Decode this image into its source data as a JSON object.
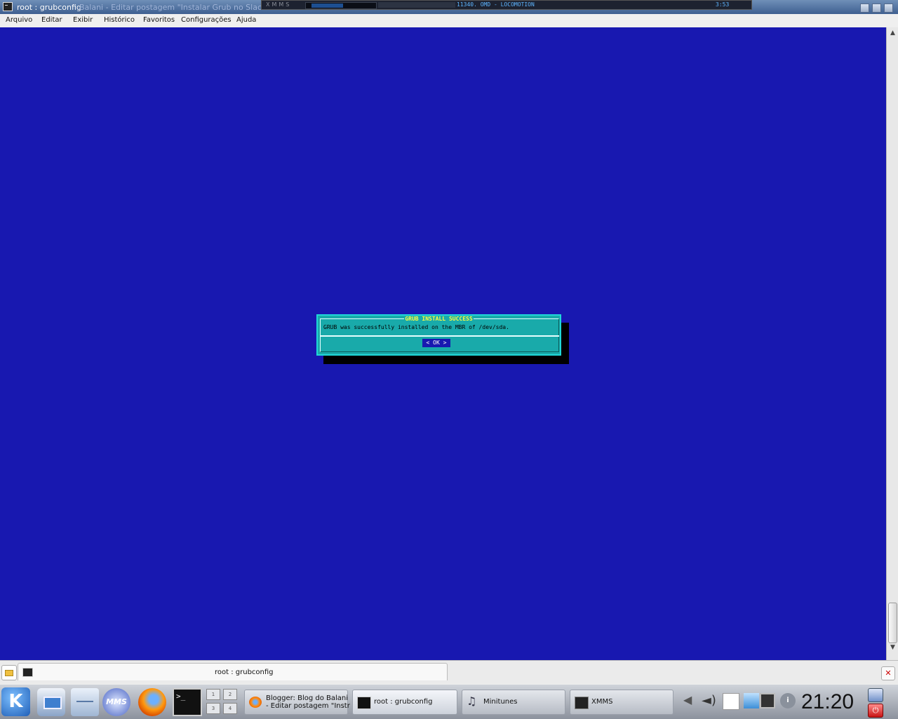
{
  "window": {
    "title_active": "root : grubconfig",
    "title_rest": "Balani - Editar postagem \"Instalar Grub no Slack"
  },
  "xmms_bar": {
    "label": "XMMS",
    "track": "11340. OMD - LOCOMOTION",
    "time": "3:53"
  },
  "menu": {
    "items": [
      "Arquivo",
      "Editar",
      "Exibir",
      "Histórico",
      "Favoritos",
      "Configurações",
      "Ajuda"
    ]
  },
  "dialog": {
    "title": "GRUB INSTALL SUCCESS",
    "message": "GRUB was successfully installed on the MBR of /dev/sda.",
    "ok_label": "<  OK  >",
    "colors": {
      "background": "#19aaaa",
      "title": "#ffff40",
      "screen": "#1818b0"
    }
  },
  "konsole_tab": {
    "label": "root : grubconfig"
  },
  "taskbar": {
    "pager": [
      "1",
      "2",
      "3",
      "4"
    ],
    "tasks": [
      {
        "line1": "Blogger: Blog do Balani",
        "line2": "- Editar postagem \"Instr"
      },
      {
        "label": "root : grubconfig"
      },
      {
        "label": "Minitunes"
      },
      {
        "label": "XMMS"
      }
    ],
    "mms_label": "MMS",
    "terminal_icon_text": ">_",
    "clock": "21:20"
  }
}
